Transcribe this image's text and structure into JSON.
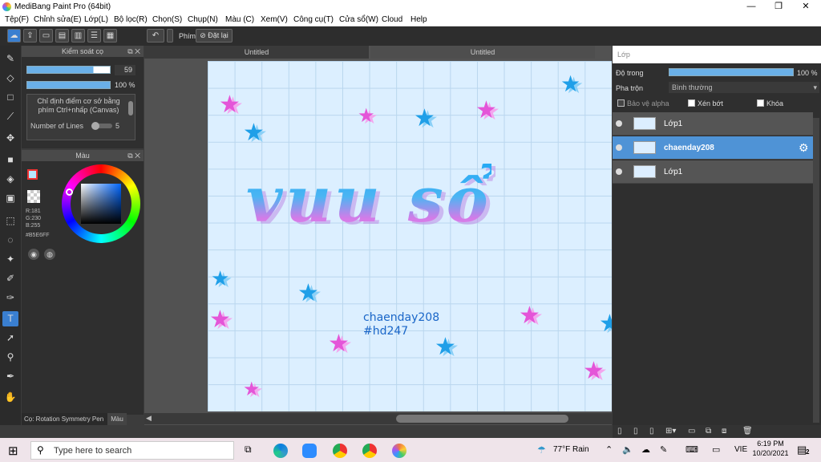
{
  "window": {
    "title": "MediBang Paint Pro (64bit)",
    "min": "—",
    "max": "❐",
    "close": "✕"
  },
  "menu": [
    "Tệp(F)",
    "Chỉnh sửa(E)",
    "Lớp(L)",
    "Bộ lọc(R)",
    "Chọn(S)",
    "Chụp(N)",
    "Màu (C)",
    "Xem(V)",
    "Công cụ(T)",
    "Cửa sổ(W)",
    "Cloud",
    "Help"
  ],
  "toolbar": {
    "key_label": "Phím",
    "reset_label": "Đặt lại"
  },
  "brush_panel": {
    "title": "Kiểm soát cọ",
    "size_value": "59",
    "opacity_value": "100 %",
    "hint": "Chỉ định điểm cơ sở bằng phím Ctrl+nhấp (Canvas)",
    "lines_label": "Number of Lines",
    "lines_value": "5"
  },
  "color_panel": {
    "title": "Màu",
    "r": "R:181",
    "g": "G:230",
    "b": "B:255",
    "hex": "#B5E6FF",
    "primary": "#b5e6ff"
  },
  "tools_status": {
    "label": "Cọ: Rotation Symmetry Pen",
    "tab": "Màu"
  },
  "canvas": {
    "tab1": "Untitled",
    "tab2": "Untitled",
    "big_text": "vuu sổ",
    "caption1": "chaenday208",
    "caption2": "#hd247",
    "bg": "#dcefff"
  },
  "layers_panel": {
    "title": "Lớp",
    "opacity_label": "Độ trong",
    "opacity_value": "100 %",
    "blend_label": "Pha trộn",
    "blend_value": "Bình thường",
    "protect_alpha": "Bảo vệ alpha",
    "clip": "Xén bớt",
    "lock": "Khóa",
    "layers": [
      {
        "name": "Lớp1",
        "selected": false
      },
      {
        "name": "chaenday208",
        "selected": true
      },
      {
        "name": "Lớp1",
        "selected": false
      }
    ]
  },
  "taskbar": {
    "search_placeholder": "Type here to search",
    "weather": "77°F  Rain",
    "lang": "VIE",
    "time": "6:19 PM",
    "date": "10/20/2021",
    "notif": "2"
  }
}
